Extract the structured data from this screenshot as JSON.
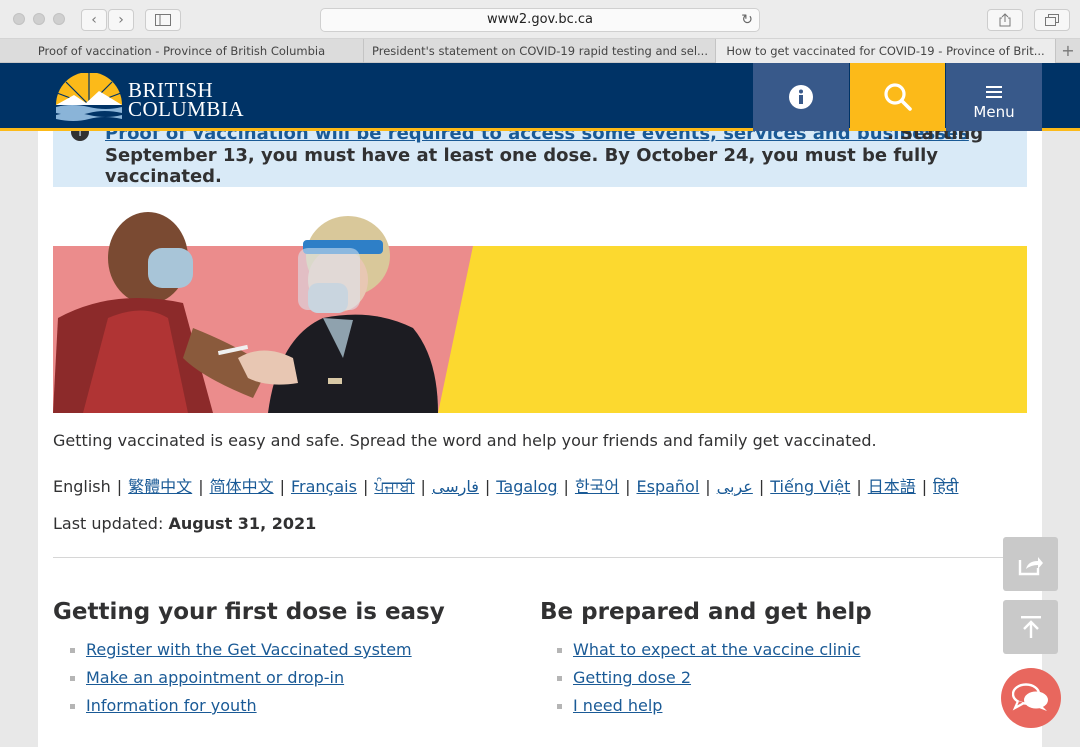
{
  "browser": {
    "url": "www2.gov.bc.ca",
    "tabs": [
      "Proof of vaccination - Province of British Columbia",
      "President's statement on COVID-19 rapid testing and sel...",
      "How to get vaccinated for COVID-19 - Province of Brit..."
    ],
    "add_tab": "+"
  },
  "header": {
    "logo_line1": "BRITISH",
    "logo_line2": "COLUMBIA",
    "menu_label": "Menu"
  },
  "alert": {
    "link_text": "Proof of vaccination will be required to access some events, services and businesses",
    "link_suffix": ". Starting",
    "text": "September 13, you must have at least one dose. By October 24, you must be fully vaccinated."
  },
  "intro": "Getting vaccinated is easy and safe. Spread the word and help your friends and family get vaccinated.",
  "languages": {
    "current": "English",
    "links": [
      "繁體中文",
      "简体中文",
      "Français",
      "ਪੰਜਾਬੀ",
      "فارسی",
      "Tagalog",
      "한국어",
      "Español",
      "عربى",
      "Tiếng Việt",
      "日本語",
      "हिंदी"
    ]
  },
  "updated": {
    "label": "Last updated:",
    "date": "August 31, 2021"
  },
  "left_col": {
    "heading": "Getting your first dose is easy",
    "items": [
      "Register with the Get Vaccinated system",
      "Make an appointment or drop-in",
      "Information for youth"
    ]
  },
  "right_col": {
    "heading": "Be prepared and get help",
    "items": [
      "What to expect at the vaccine clinic",
      "Getting dose 2",
      "I need help"
    ]
  },
  "colors": {
    "bc_blue": "#003366",
    "bc_gold": "#fcba19",
    "link": "#1a5a96",
    "alert_bg": "#d9eaf7",
    "hero_pink": "#eb8c8c",
    "hero_yellow": "#fcd92f"
  }
}
